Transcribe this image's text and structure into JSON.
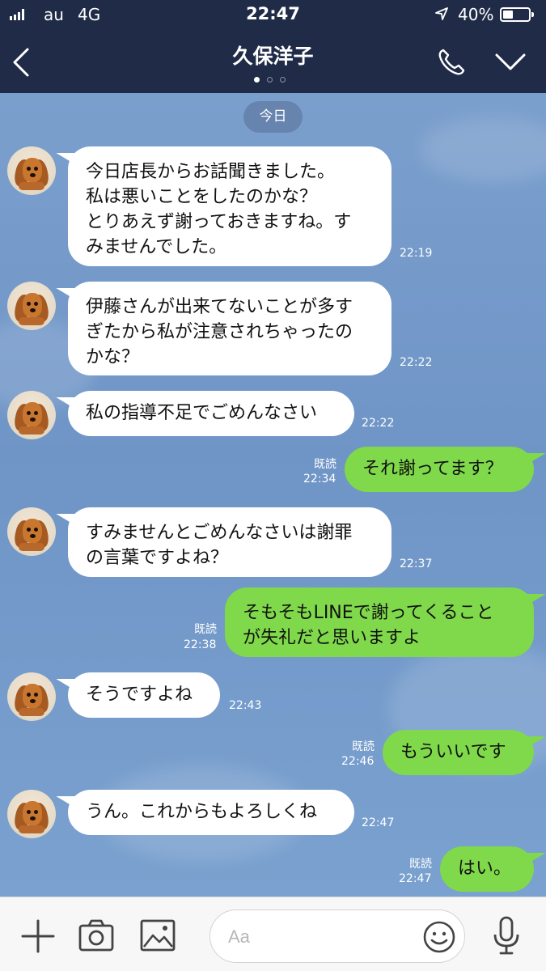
{
  "status_bar": {
    "carrier": "au",
    "network": "4G",
    "time": "22:47",
    "battery_percent": "40%",
    "battery_level": 0.4
  },
  "header": {
    "title": "久保洋子",
    "page_dots": 3,
    "active_dot": 0
  },
  "chat": {
    "date_label": "今日",
    "messages": [
      {
        "from": "them",
        "text": "今日店長からお話聞きました。\n私は悪いことをしたのかな？\nとりあえず謝っておきますね。す\nみませんでした。",
        "time": "22:19"
      },
      {
        "from": "them",
        "text": "伊藤さんが出来てないことが多す\nぎたから私が注意されちゃったの\nかな？",
        "time": "22:22"
      },
      {
        "from": "them",
        "text": "私の指導不足でごめんなさい",
        "time": "22:22"
      },
      {
        "from": "me",
        "text": "それ謝ってます？",
        "time": "22:34",
        "read": "既読"
      },
      {
        "from": "them",
        "text": "すみませんとごめんなさいは謝罪\nの言葉ですよね？",
        "time": "22:37"
      },
      {
        "from": "me",
        "text": "そもそもLINEで謝ってくること\nが失礼だと思いますよ",
        "time": "22:38",
        "read": "既読"
      },
      {
        "from": "them",
        "text": "そうですよね",
        "time": "22:43"
      },
      {
        "from": "me",
        "text": "もういいです",
        "time": "22:46",
        "read": "既読"
      },
      {
        "from": "them",
        "text": "うん。これからもよろしくね",
        "time": "22:47"
      },
      {
        "from": "me",
        "text": "はい。",
        "time": "22:47",
        "read": "既読"
      }
    ]
  },
  "input_bar": {
    "placeholder": "Aa",
    "icons": [
      "plus-icon",
      "camera-icon",
      "image-icon",
      "emoji-icon",
      "microphone-icon"
    ]
  },
  "colors": {
    "header_bg": "#1f2b47",
    "chat_bg": "#7399c9",
    "outgoing_bubble": "#7fd94a",
    "incoming_bubble": "#ffffff"
  }
}
